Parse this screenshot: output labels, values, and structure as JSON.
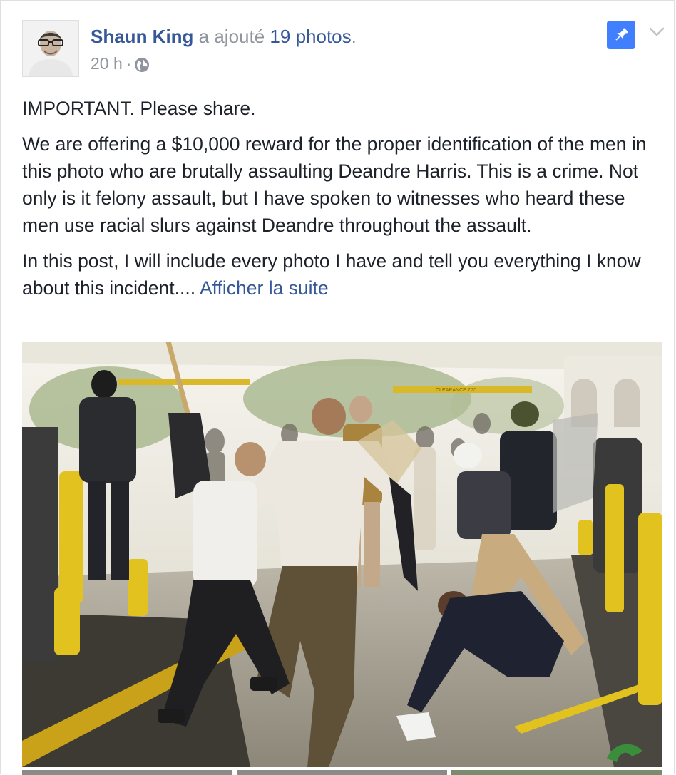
{
  "post": {
    "author": "Shaun King",
    "action": " a ajouté ",
    "photos_label": "19 photos",
    "period": ".",
    "timestamp": "20 h",
    "separator": "·",
    "privacy_icon": "globe-icon",
    "pin_icon": "pin-icon",
    "menu_icon": "chevron-down-icon",
    "accent_color": "#365899",
    "pin_color": "#4080ff"
  },
  "body": {
    "paragraph_1": "IMPORTANT. Please share.",
    "paragraph_2": "We are offering a $10,000 reward for the proper identification of the men in this photo who are brutally assaulting Deandre Harris. This is a crime. Not only is it felony assault, but I have spoken to witnesses who heard these men use racial slurs against Deandre throughout the assault.",
    "paragraph_3": "In this post, I will include every photo I have and tell you everything I know about this incident.... ",
    "see_more": "Afficher la suite"
  },
  "photo": {
    "clearance_sign": "CLEARANCE 7'3\""
  }
}
